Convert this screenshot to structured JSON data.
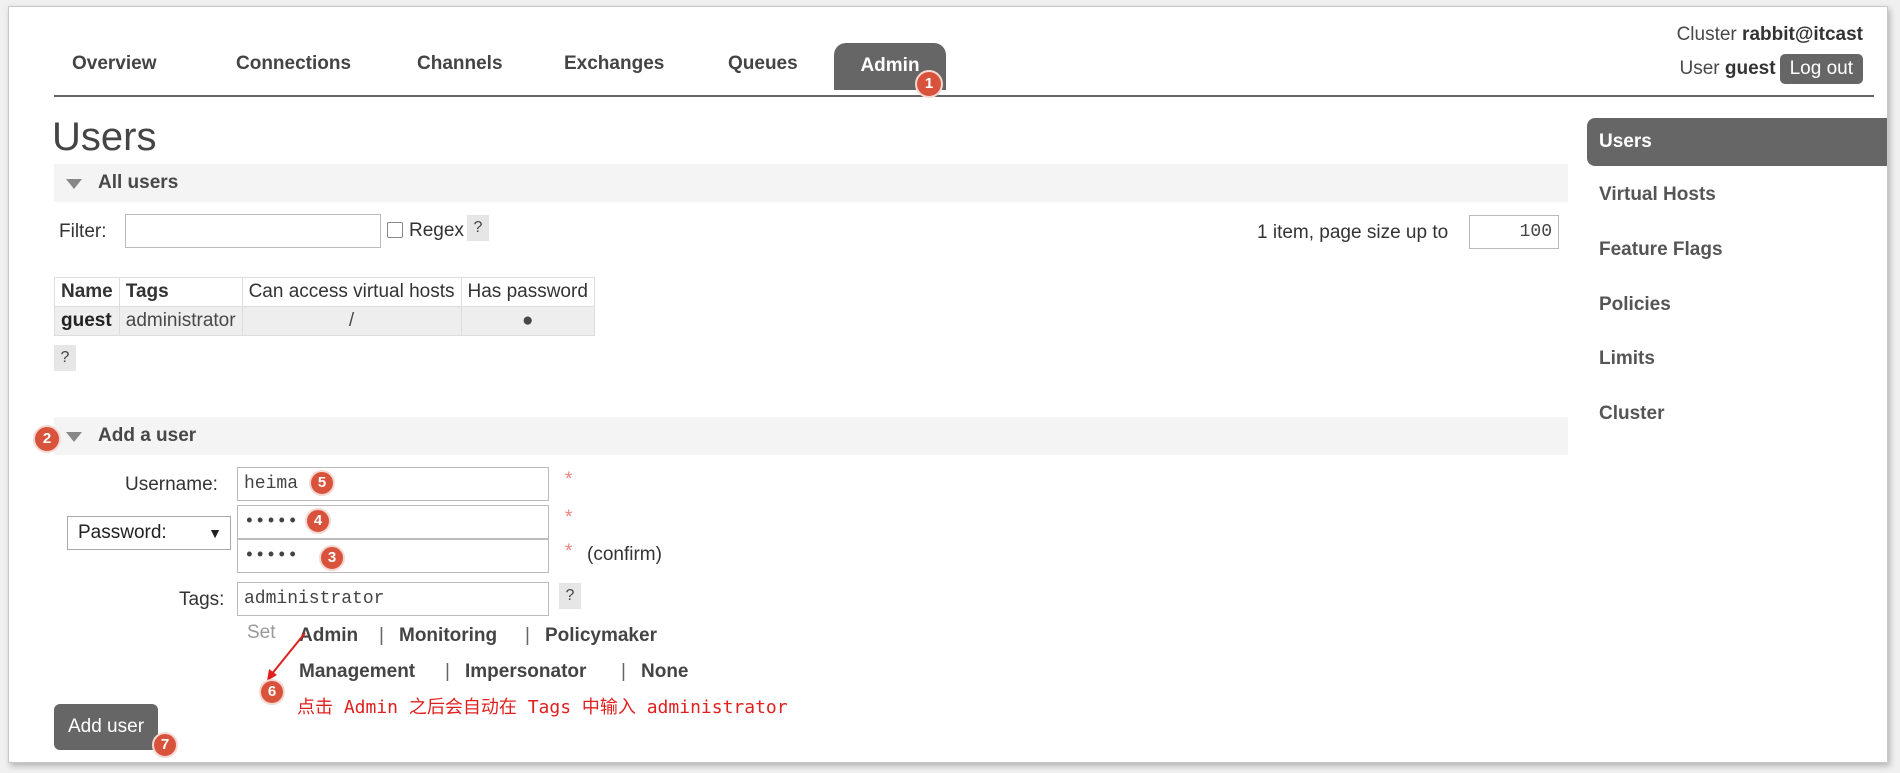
{
  "header": {
    "cluster_label": "Cluster",
    "cluster_name": "rabbit@itcast",
    "user_label": "User",
    "user_name": "guest",
    "logout_label": "Log out"
  },
  "tabs": [
    {
      "label": "Overview"
    },
    {
      "label": "Connections"
    },
    {
      "label": "Channels"
    },
    {
      "label": "Exchanges"
    },
    {
      "label": "Queues"
    },
    {
      "label": "Admin",
      "active": true
    }
  ],
  "page_title": "Users",
  "all_users": {
    "section_label": "All users",
    "filter_label": "Filter:",
    "filter_value": "",
    "regex_label": "Regex",
    "help": "?",
    "paging_text": "1 item, page size up to",
    "page_size": "100",
    "columns": [
      "Name",
      "Tags",
      "Can access virtual hosts",
      "Has password"
    ],
    "rows": [
      {
        "name": "guest",
        "tags": "administrator",
        "vhosts": "/",
        "has_password": "●"
      }
    ]
  },
  "add_user": {
    "section_label": "Add a user",
    "username_label": "Username:",
    "username_value": "heima",
    "password_type": "Password:",
    "password_value": "•••••",
    "password_confirm_value": "•••••",
    "required_mark": "*",
    "confirm_label": "(confirm)",
    "tags_label": "Tags:",
    "tags_value": "administrator",
    "set_label": "Set",
    "tag_options": [
      "Admin",
      "Monitoring",
      "Policymaker",
      "Management",
      "Impersonator",
      "None"
    ],
    "separator": "|",
    "submit_label": "Add user"
  },
  "sidebar": {
    "items": [
      {
        "label": "Users",
        "active": true
      },
      {
        "label": "Virtual Hosts"
      },
      {
        "label": "Feature Flags"
      },
      {
        "label": "Policies"
      },
      {
        "label": "Limits"
      },
      {
        "label": "Cluster"
      }
    ]
  },
  "annotations": {
    "markers": [
      "1",
      "2",
      "3",
      "4",
      "5",
      "6",
      "7"
    ],
    "note": "点击 Admin 之后会自动在 Tags 中输入 administrator",
    "arrow_color": "#e0201f",
    "badge_color": "#d9533c"
  },
  "colors": {
    "accent": "#666666",
    "required": "#f08080"
  }
}
